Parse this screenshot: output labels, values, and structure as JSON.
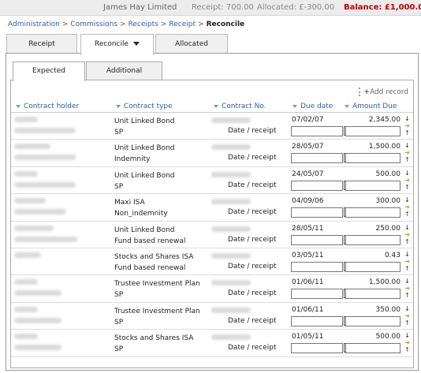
{
  "header": {
    "title": "James Hay Limited",
    "receipt": "Receipt: 700.00",
    "allocated": "Allocated: £-300.00",
    "balance": "Balance: £1,000.00"
  },
  "breadcrumb": {
    "items": [
      "Administration",
      "Commissions",
      "Receipts",
      "Receipt"
    ],
    "separator": ">",
    "current": "Reconcile"
  },
  "main_tabs": [
    "Receipt",
    "Reconcile",
    "Allocated"
  ],
  "sub_tabs": [
    "Expected",
    "Additional"
  ],
  "add_record": "Add record",
  "columns": [
    "Contract holder",
    "Contract type",
    "Contract No.",
    "Due date",
    "Amount Due"
  ],
  "date_receipt_label": "Date / receipt",
  "rows": [
    {
      "type": "Unit Linked Bond",
      "sub": "SP",
      "due": "07/02/07",
      "amount": "2,345.00"
    },
    {
      "type": "Unit Linked Bond",
      "sub": "Indemnity",
      "due": "28/05/07",
      "amount": "1,500.00"
    },
    {
      "type": "Unit Linked Bond",
      "sub": "SP",
      "due": "24/05/07",
      "amount": "500.00"
    },
    {
      "type": "Maxi ISA",
      "sub": "Non_indemnity",
      "due": "04/09/06",
      "amount": "300.00"
    },
    {
      "type": "Unit Linked Bond",
      "sub": "Fund based renewal",
      "due": "28/05/11",
      "amount": "250.00"
    },
    {
      "type": "Stocks and Shares ISA",
      "sub": "Fund based renewal",
      "due": "03/05/11",
      "amount": "0.43"
    },
    {
      "type": "Trustee Investment Plan",
      "sub": "SP",
      "due": "01/06/11",
      "amount": "1,500.00"
    },
    {
      "type": "Trustee Investment Plan",
      "sub": "SP",
      "due": "01/06/11",
      "amount": "350.00"
    },
    {
      "type": "Stocks and Shares ISA",
      "sub": "SP",
      "due": "01/05/11",
      "amount": "500.00"
    }
  ],
  "icons": {
    "add": "plus-icon",
    "calendar": "calendar-icon",
    "move_down": "arrow-down-icon",
    "allocate": "arrow-right-icon",
    "move_up": "arrow-up-icon",
    "sort": "sort-down-icon"
  },
  "colors": {
    "balance": "#c00000",
    "link": "#2a5fa8",
    "add_plus": "#3a7a1a",
    "allocate_arrow": "#7bb33a",
    "up_arrow": "#c00000"
  }
}
